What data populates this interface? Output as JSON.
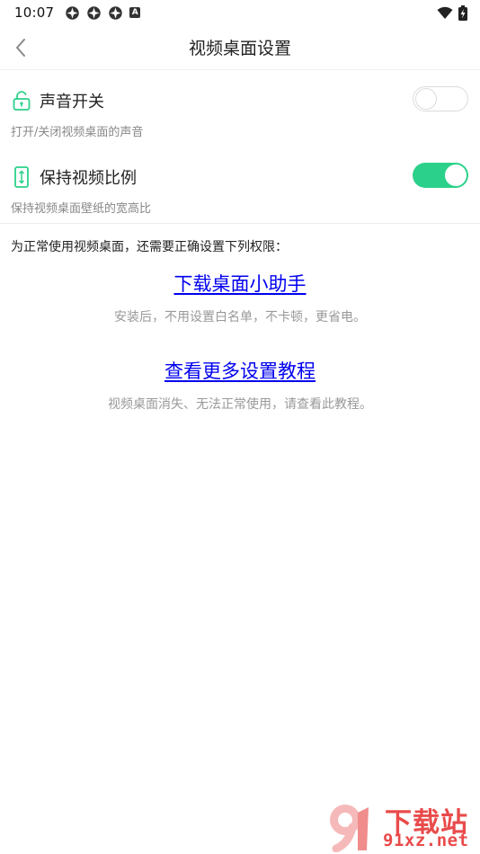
{
  "status_bar": {
    "time": "10:07",
    "notification_icons": [
      "app-notification-icon",
      "app-notification-icon",
      "app-notification-icon"
    ],
    "a_label": "A",
    "right_icons": [
      "wifi-icon",
      "battery-charging-icon"
    ]
  },
  "header": {
    "title": "视频桌面设置",
    "back_icon": "back-chevron-icon"
  },
  "settings": {
    "sound": {
      "icon": "unlock-icon",
      "label": "声音开关",
      "description": "打开/关闭视频桌面的声音",
      "enabled": false
    },
    "ratio": {
      "icon": "phone-ratio-icon",
      "label": "保持视频比例",
      "description": "保持视频桌面壁纸的宽高比",
      "enabled": true
    }
  },
  "permissions": {
    "intro": "为正常使用视频桌面，还需要正确设置下列权限：",
    "links": [
      {
        "label": "下载桌面小助手",
        "description": "安装后，不用设置白名单，不卡顿，更省电。"
      },
      {
        "label": "查看更多设置教程",
        "description": "视频桌面消失、无法正常使用，请查看此教程。"
      }
    ]
  },
  "colors": {
    "accent": "#2bd18a",
    "link": "#0000ee",
    "watermark": "#e94b4b"
  },
  "watermark": {
    "brand": "下载站",
    "url": "91xz.net"
  }
}
